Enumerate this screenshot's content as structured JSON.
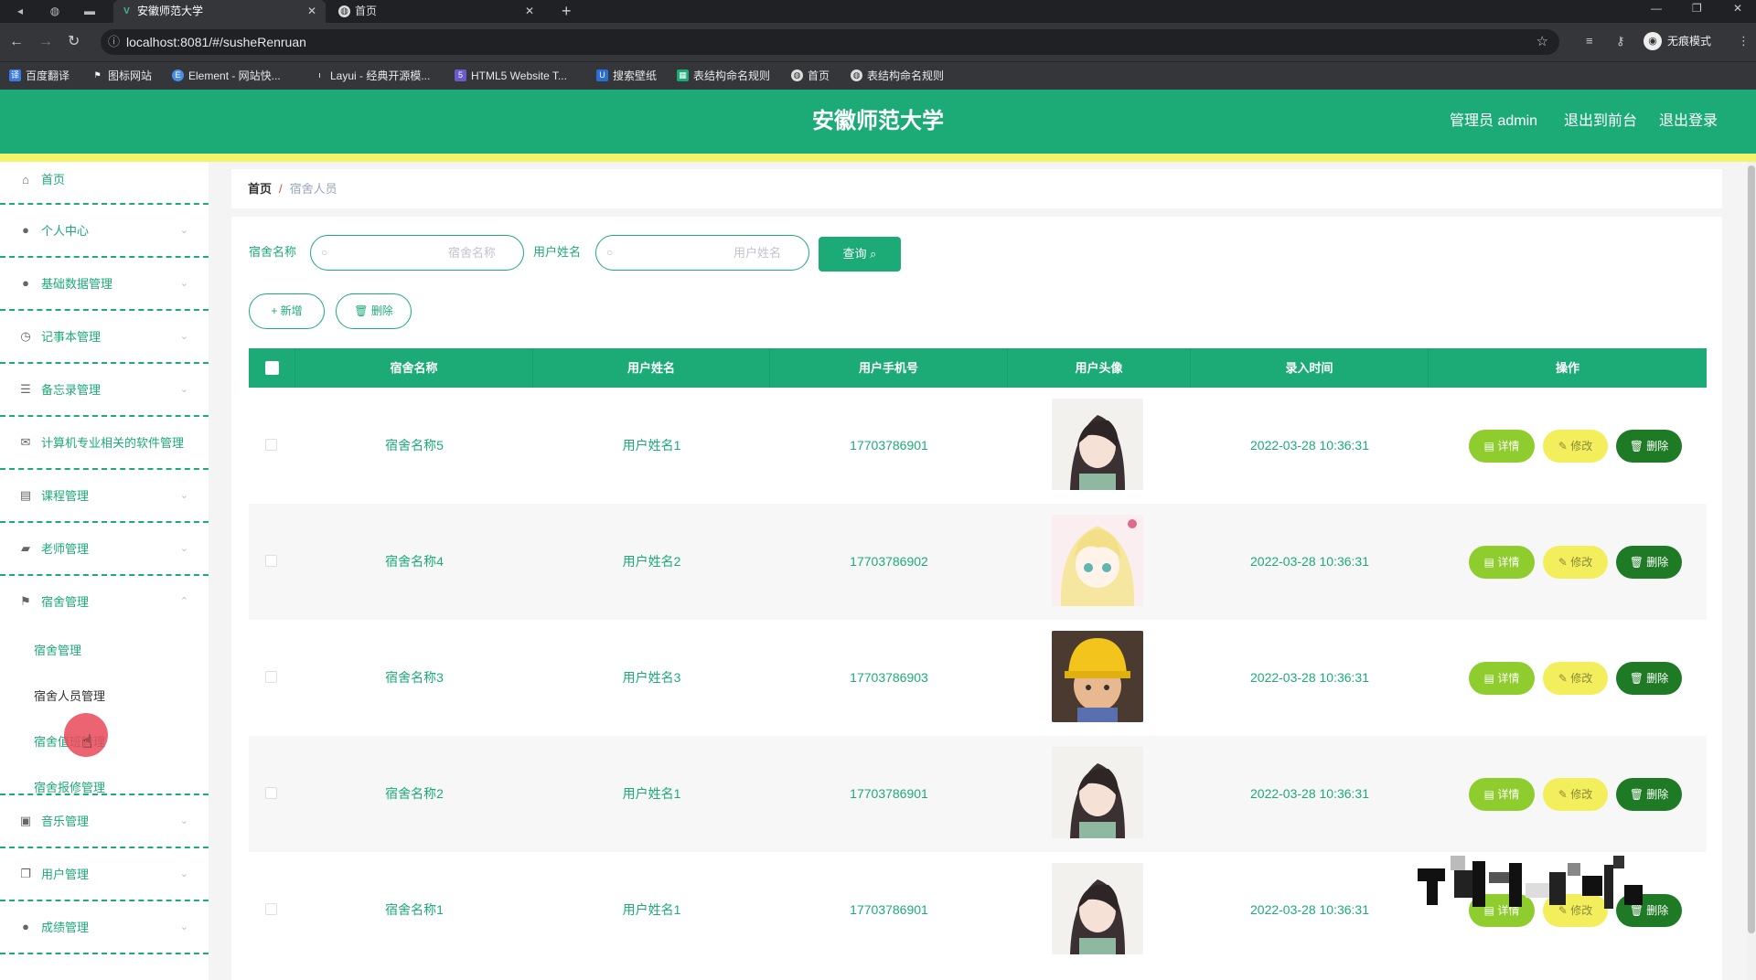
{
  "browser": {
    "tabs": [
      {
        "title": "安徽师范大学",
        "active": true
      },
      {
        "title": "首页",
        "active": false
      }
    ],
    "url": "localhost:8081/#/susheRenruan",
    "profile_label": "无痕模式",
    "bookmarks": [
      "百度翻译",
      "图标网站",
      "Element - 网站快...",
      "Layui - 经典开源模...",
      "HTML5 Website T...",
      "搜索壁纸",
      "表结构命名规则",
      "首页",
      "表结构命名规则"
    ]
  },
  "header": {
    "title": "安徽师范大学",
    "admin_label": "管理员 admin",
    "exit_front": "退出到前台",
    "logout": "退出登录"
  },
  "sidebar": {
    "items": [
      {
        "label": "首页",
        "icon": "home-icon"
      },
      {
        "label": "个人中心",
        "icon": "user-icon"
      },
      {
        "label": "基础数据管理",
        "icon": "user-icon"
      },
      {
        "label": "记事本管理",
        "icon": "clock-icon"
      },
      {
        "label": "备忘录管理",
        "icon": "sliders-icon"
      },
      {
        "label": "计算机专业相关的软件管理",
        "icon": "mail-icon"
      },
      {
        "label": "课程管理",
        "icon": "briefcase-icon"
      },
      {
        "label": "老师管理",
        "icon": "tag-icon"
      },
      {
        "label": "宿舍管理",
        "icon": "flag-icon"
      },
      {
        "label": "音乐管理",
        "icon": "printer-icon"
      },
      {
        "label": "用户管理",
        "icon": "copy-icon"
      },
      {
        "label": "成绩管理",
        "icon": "user-icon"
      }
    ],
    "sub_items": [
      "宿舍管理",
      "宿舍人员管理",
      "宿舍值班管理",
      "宿舍报修管理"
    ],
    "active_sub": "宿舍人员管理"
  },
  "breadcrumb": {
    "home": "首页",
    "sep": "/",
    "current": "宿舍人员"
  },
  "filters": {
    "dorm_label": "宿舍名称",
    "dorm_placeholder": "宿舍名称",
    "user_label": "用户姓名",
    "user_placeholder": "用户姓名",
    "query_button": "查询"
  },
  "actions": {
    "add": "+ 新增",
    "delete": "删除"
  },
  "table": {
    "columns": [
      "宿舍名称",
      "用户姓名",
      "用户手机号",
      "用户头像",
      "录入时间",
      "操作"
    ],
    "rows": [
      {
        "dorm": "宿舍名称5",
        "user": "用户姓名1",
        "phone": "17703786901",
        "avatar": "girl-avatar",
        "time": "2022-03-28 10:36:31"
      },
      {
        "dorm": "宿舍名称4",
        "user": "用户姓名2",
        "phone": "17703786902",
        "avatar": "anime-blonde-avatar",
        "time": "2022-03-28 10:36:31"
      },
      {
        "dorm": "宿舍名称3",
        "user": "用户姓名3",
        "phone": "17703786903",
        "avatar": "yellow-hat-boy-avatar",
        "time": "2022-03-28 10:36:31"
      },
      {
        "dorm": "宿舍名称2",
        "user": "用户姓名1",
        "phone": "17703786901",
        "avatar": "girl-avatar",
        "time": "2022-03-28 10:36:31"
      },
      {
        "dorm": "宿舍名称1",
        "user": "用户姓名1",
        "phone": "17703786901",
        "avatar": "girl-avatar",
        "time": "2022-03-28 10:36:31"
      }
    ],
    "ops": {
      "detail": "详情",
      "edit": "修改",
      "delete": "删除"
    }
  },
  "colors": {
    "primary": "#1cab77",
    "accent_bar": "#f5f36a",
    "detail_btn": "#8fcc2e",
    "edit_btn": "#f3ee5c",
    "delete_btn": "#1f7a25"
  }
}
